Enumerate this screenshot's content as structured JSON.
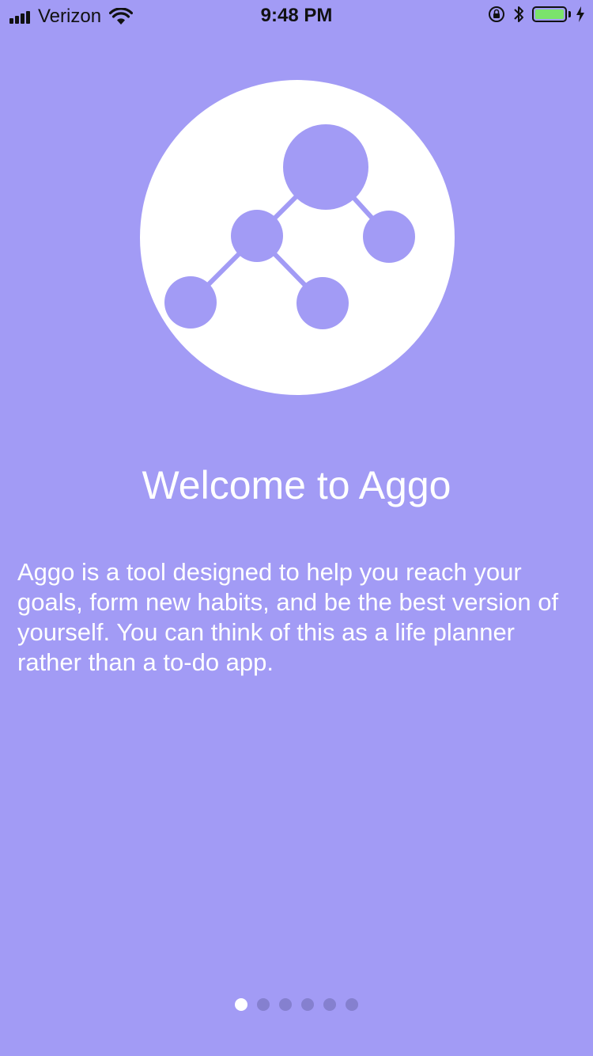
{
  "status_bar": {
    "carrier": "Verizon",
    "time": "9:48 PM",
    "battery_level": 1.0
  },
  "logo": {
    "icon": "node-tree-icon",
    "circle_color": "#ffffff",
    "node_color": "#a29bf5"
  },
  "onboarding": {
    "title": "Welcome to Aggo",
    "body": "Aggo is a tool designed to help you reach your goals, form new habits, and be the best version of yourself. You can think of this as a life planner rather than a to-do app."
  },
  "pager": {
    "total_pages": 6,
    "current_page": 1
  },
  "colors": {
    "background": "#a29bf5",
    "dot_active": "#ffffff",
    "dot_inactive": "#8580cf",
    "battery": "#7be36c"
  }
}
